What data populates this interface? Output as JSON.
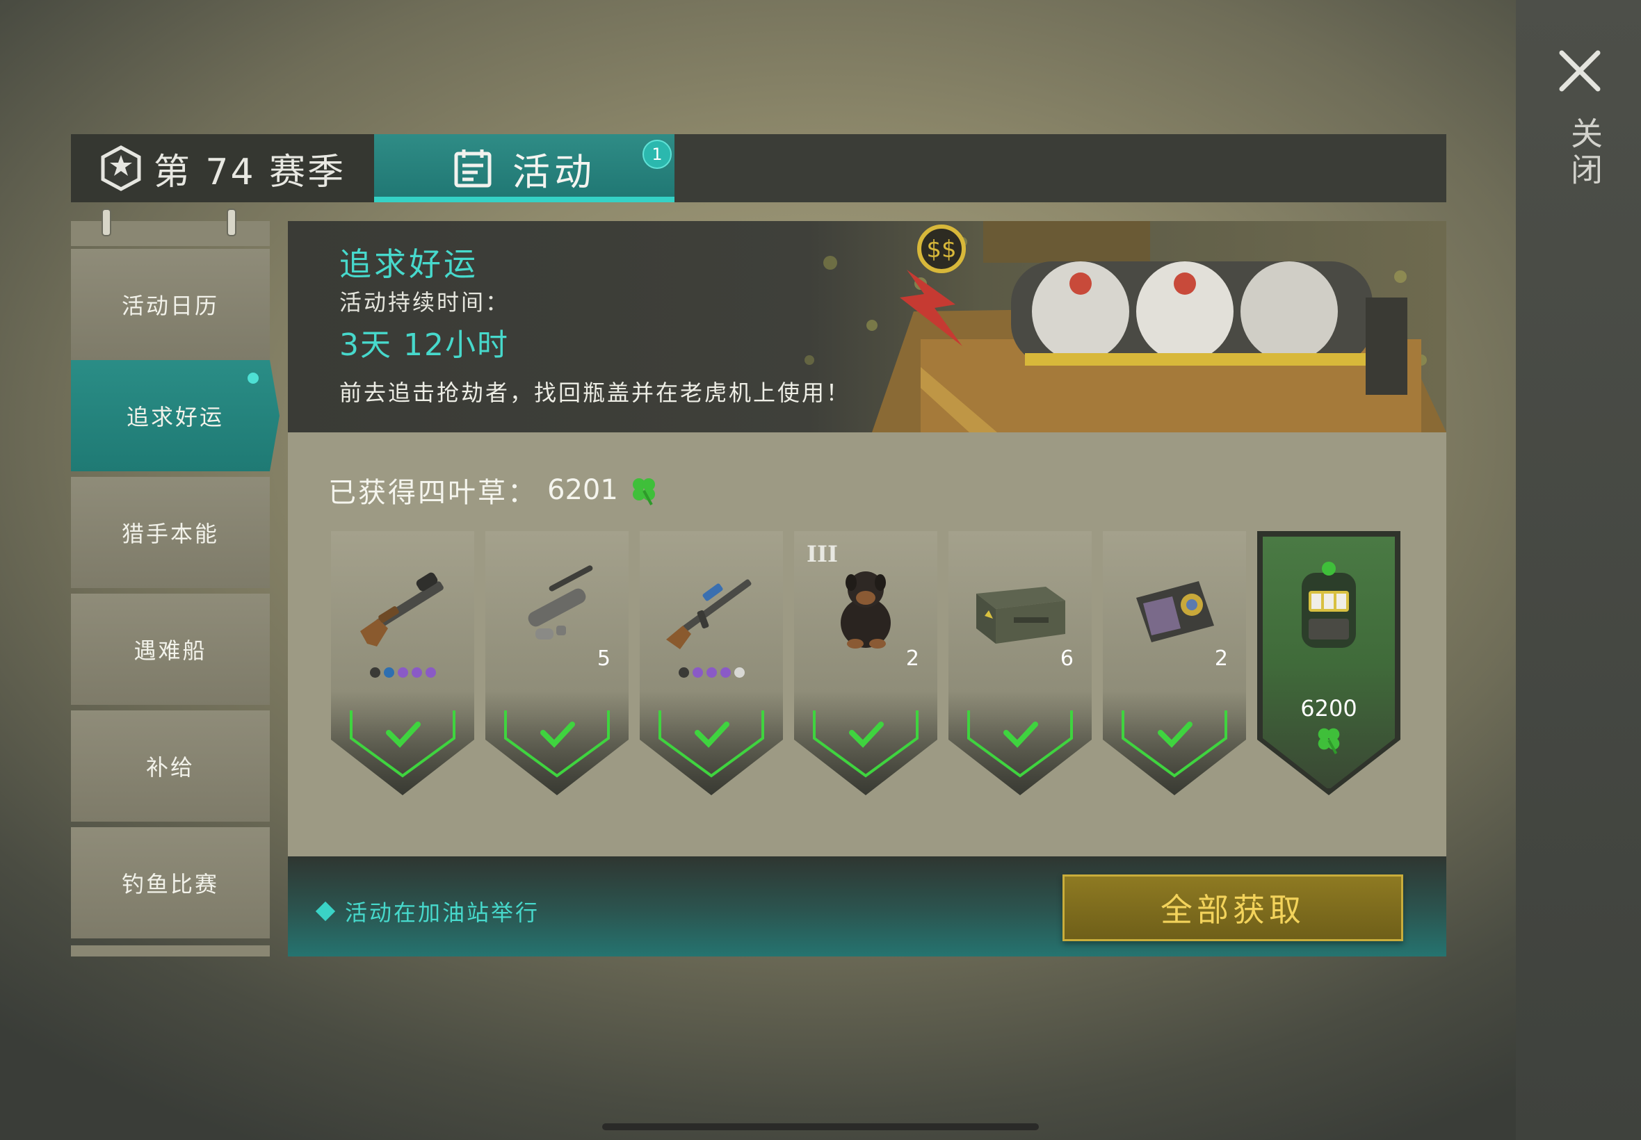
{
  "close": {
    "label": "关闭",
    "icon": "close-icon"
  },
  "tabs": [
    {
      "label": "第 74 赛季",
      "icon": "season-shield-icon",
      "active": false
    },
    {
      "label": "活动",
      "icon": "calendar-icon",
      "active": true,
      "badge": "1"
    }
  ],
  "sidebar": {
    "items": [
      {
        "label": "活动日历",
        "active": false
      },
      {
        "label": "追求好运",
        "active": true,
        "new_dot": true
      },
      {
        "label": "猎手本能",
        "active": false
      },
      {
        "label": "遇难船",
        "active": false
      },
      {
        "label": "补给",
        "active": false
      },
      {
        "label": "钓鱼比赛",
        "active": false
      }
    ]
  },
  "banner": {
    "title": "追求好运",
    "duration_label": "活动持续时间：",
    "duration": "3天 12小时",
    "description": "前去追击抢劫者，找回瓶盖并在老虎机上使用！"
  },
  "clovers": {
    "label": "已获得四叶草：",
    "value": "6201",
    "icon": "four-leaf-clover-icon"
  },
  "rewards": [
    {
      "icon": "shotgun-icon",
      "count": "",
      "tier": "",
      "claimed": true,
      "rarity_dots": [
        "#3a3a36",
        "#2e6fb0",
        "#8a5ac6",
        "#8a5ac6",
        "#8a5ac6"
      ]
    },
    {
      "icon": "weapon-parts-icon",
      "count": "5",
      "tier": "",
      "claimed": true,
      "rarity_dots": []
    },
    {
      "icon": "assault-rifle-icon",
      "count": "",
      "tier": "",
      "claimed": true,
      "rarity_dots": [
        "#3a3a36",
        "#8a5ac6",
        "#8a5ac6",
        "#8a5ac6",
        "#d8d8d4"
      ]
    },
    {
      "icon": "dog-icon",
      "count": "2",
      "tier": "III",
      "claimed": true,
      "rarity_dots": []
    },
    {
      "icon": "military-crate-icon",
      "count": "6",
      "tier": "",
      "claimed": true,
      "rarity_dots": []
    },
    {
      "icon": "badge-wallet-icon",
      "count": "2",
      "tier": "",
      "claimed": true,
      "rarity_dots": []
    },
    {
      "icon": "slot-machine-icon",
      "count": "",
      "tier": "",
      "claimed": false,
      "cost": "6200"
    }
  ],
  "footer": {
    "info": "活动在加油站举行",
    "claim_all": "全部获取"
  },
  "colors": {
    "accent": "#2bb8ae",
    "accent_text": "#47d9cc",
    "gold_button": "#8e7a22",
    "check_green": "#3fd43f",
    "clover_green": "#3fbf3a"
  }
}
